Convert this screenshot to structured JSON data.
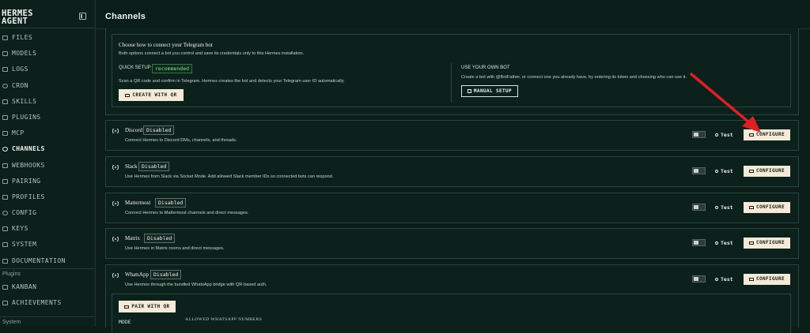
{
  "app": {
    "brand_line1": "HERMES",
    "brand_line2": "AGENT"
  },
  "sidebar": {
    "items": [
      {
        "label": "FILES",
        "icon": "folder-icon",
        "active": false
      },
      {
        "label": "MODELS",
        "icon": "cube-icon",
        "active": false
      },
      {
        "label": "LOGS",
        "icon": "file-text-icon",
        "active": false
      },
      {
        "label": "CRON",
        "icon": "clock-icon",
        "active": false
      },
      {
        "label": "SKILLS",
        "icon": "package-icon",
        "active": false
      },
      {
        "label": "PLUGINS",
        "icon": "puzzle-icon",
        "active": false
      },
      {
        "label": "MCP",
        "icon": "plug-icon",
        "active": false
      },
      {
        "label": "CHANNELS",
        "icon": "radio-icon",
        "active": true
      },
      {
        "label": "WEBHOOKS",
        "icon": "webhook-icon",
        "active": false
      },
      {
        "label": "PAIRING",
        "icon": "link-icon",
        "active": false
      },
      {
        "label": "PROFILES",
        "icon": "users-icon",
        "active": false
      },
      {
        "label": "CONFIG",
        "icon": "gear-icon",
        "active": false
      },
      {
        "label": "KEYS",
        "icon": "key-icon",
        "active": false
      },
      {
        "label": "SYSTEM",
        "icon": "wrench-icon",
        "active": false
      },
      {
        "label": "DOCUMENTATION",
        "icon": "book-icon",
        "active": false
      }
    ],
    "plugins_label": "Plugins",
    "plugin_items": [
      {
        "label": "KANBAN",
        "icon": "kanban-icon"
      },
      {
        "label": "ACHIEVEMENTS",
        "icon": "trophy-icon"
      }
    ],
    "system_label": "System"
  },
  "header": {
    "title": "Channels"
  },
  "telegram": {
    "heading": "Choose how to connect your Telegram bot",
    "subtitle": "Both options connect a bot you control and save its credentials only to this Hermes installation.",
    "quick_setup": {
      "label": "QUICK SETUP",
      "badge": "recommended",
      "description": "Scan a QR code and confirm in Telegram. Hermes creates the bot and detects your Telegram user ID automatically.",
      "button": "CREATE WITH QR"
    },
    "own_bot": {
      "label": "USE YOUR OWN BOT",
      "description": "Create a bot with @BotFather, or connect one you already have, by entering its token and choosing who can use it.",
      "button": "MANUAL SETUP"
    }
  },
  "channels": [
    {
      "name": "Discord",
      "status": "Disabled",
      "description": "Connect Hermes to Discord DMs, channels, and threads.",
      "test_label": "Test",
      "configure_label": "CONFIGURE"
    },
    {
      "name": "Slack",
      "status": "Disabled",
      "description": "Use Hermes from Slack via Socket Mode. Add allowed Slack member IDs so connected bots can respond.",
      "test_label": "Test",
      "configure_label": "CONFIGURE"
    },
    {
      "name": "Mattermost",
      "status": "Disabled",
      "description": "Connect Hermes to Mattermost channels and direct messages.",
      "test_label": "Test",
      "configure_label": "CONFIGURE"
    },
    {
      "name": "Matrix",
      "status": "Disabled",
      "description": "Use Hermes in Matrix rooms and direct messages.",
      "test_label": "Test",
      "configure_label": "CONFIGURE"
    },
    {
      "name": "WhatsApp",
      "status": "Disabled",
      "description": "Use Hermes through the bundled WhatsApp bridge with QR-based auth.",
      "test_label": "Test",
      "configure_label": "CONFIGURE"
    }
  ],
  "whatsapp_extra": {
    "pair_button": "PAIR WITH QR",
    "mode_label": "MODE",
    "allowed_label": "ALLOWED WHATSAPP NUMBERS"
  },
  "colors": {
    "background": "#0a1d19",
    "accent_button": "#f4ead7",
    "annotation_arrow": "#e02020",
    "recommended_badge": "#7be08f"
  }
}
